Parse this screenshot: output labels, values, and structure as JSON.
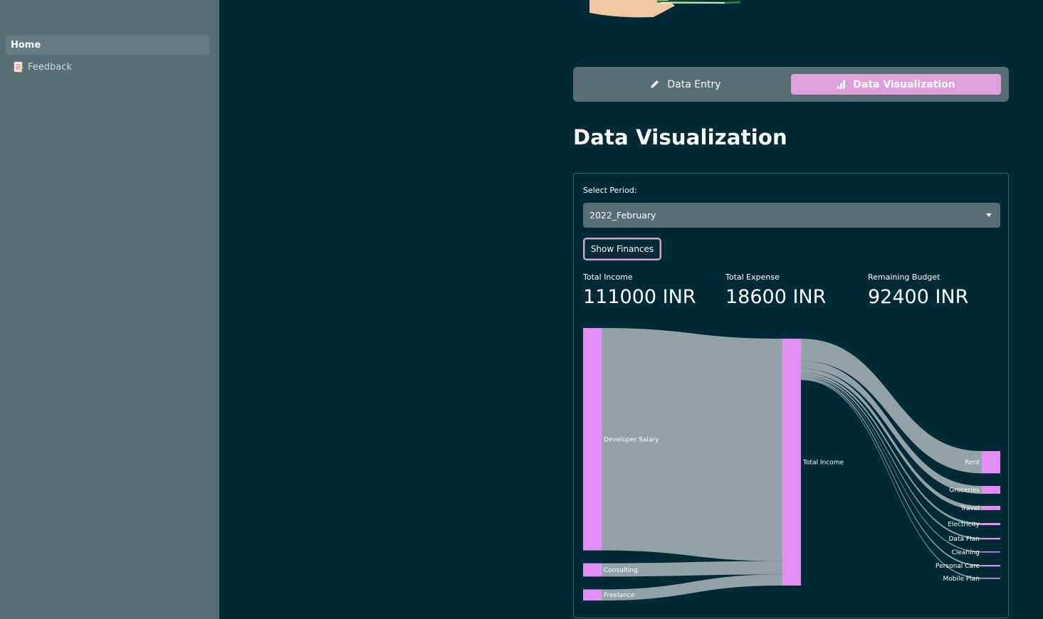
{
  "sidebar": {
    "items": [
      {
        "label": "Home"
      },
      {
        "label": "Feedback",
        "icon": "memo-icon"
      }
    ]
  },
  "tabs": [
    {
      "label": "Data Entry",
      "icon": "pencil-icon"
    },
    {
      "label": "Data Visualization",
      "icon": "bar-chart-icon",
      "active": true
    }
  ],
  "main": {
    "title": "Data Visualization",
    "select_label": "Select Period:",
    "selected_period": "2022_February",
    "button_label": "Show Finances"
  },
  "metrics": [
    {
      "label": "Total Income",
      "value": "111000 INR"
    },
    {
      "label": "Total Expense",
      "value": "18600 INR"
    },
    {
      "label": "Remaining Budget",
      "value": "92400 INR"
    }
  ],
  "colors": {
    "background": "#002b36",
    "sidebar": "#586e75",
    "accent": "#dda0dd",
    "node": "#e38ef5",
    "link": "#9aa9ad"
  },
  "chart_data": {
    "type": "sankey",
    "nodes": [
      "Developer Salary",
      "Consulting",
      "Freelance",
      "Total Income",
      "Rent",
      "Groceries",
      "Travel",
      "Electricity",
      "Data Plan",
      "Cleaning",
      "Personal Care",
      "Mobile Plan"
    ],
    "links": [
      {
        "source": "Developer Salary",
        "target": "Total Income",
        "value": 100000
      },
      {
        "source": "Consulting",
        "target": "Total Income",
        "value": 6000
      },
      {
        "source": "Freelance",
        "target": "Total Income",
        "value": 5000
      },
      {
        "source": "Total Income",
        "target": "Rent",
        "value": 10000
      },
      {
        "source": "Total Income",
        "target": "Groceries",
        "value": 3500
      },
      {
        "source": "Total Income",
        "target": "Travel",
        "value": 1900
      },
      {
        "source": "Total Income",
        "target": "Electricity",
        "value": 1000
      },
      {
        "source": "Total Income",
        "target": "Data Plan",
        "value": 700
      },
      {
        "source": "Total Income",
        "target": "Cleaning",
        "value": 300
      },
      {
        "source": "Total Income",
        "target": "Personal Care",
        "value": 700
      },
      {
        "source": "Total Income",
        "target": "Mobile Plan",
        "value": 500
      }
    ]
  }
}
